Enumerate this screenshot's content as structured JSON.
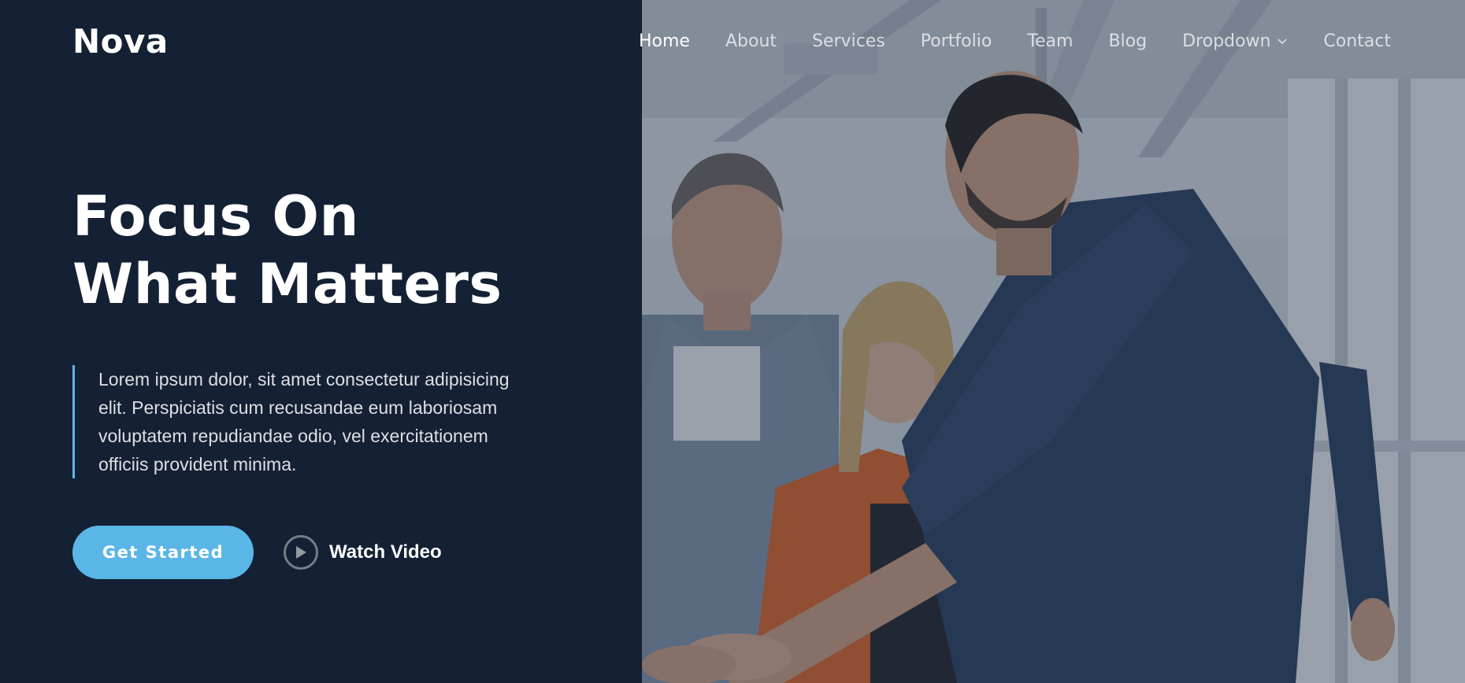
{
  "header": {
    "logo": "Nova",
    "nav": [
      {
        "label": "Home",
        "active": true
      },
      {
        "label": "About"
      },
      {
        "label": "Services"
      },
      {
        "label": "Portfolio"
      },
      {
        "label": "Team"
      },
      {
        "label": "Blog"
      },
      {
        "label": "Dropdown",
        "icon": "chevron-down-icon"
      },
      {
        "label": "Contact"
      }
    ]
  },
  "hero": {
    "title_line1": "Focus On",
    "title_line2": "What Matters",
    "text": "Lorem ipsum dolor, sit amet consectetur adipisicing elit. Perspiciatis cum recusandae eum laboriosam voluptatem repudiandae odio, vel exercitationem officiis provident minima.",
    "cta_primary": "Get Started",
    "cta_secondary": "Watch Video",
    "cta_secondary_icon": "play-icon",
    "image_icon": "team-photo"
  },
  "colors": {
    "dark_navy": "#142033",
    "accent": "#5bb6e8",
    "white": "#ffffff"
  }
}
